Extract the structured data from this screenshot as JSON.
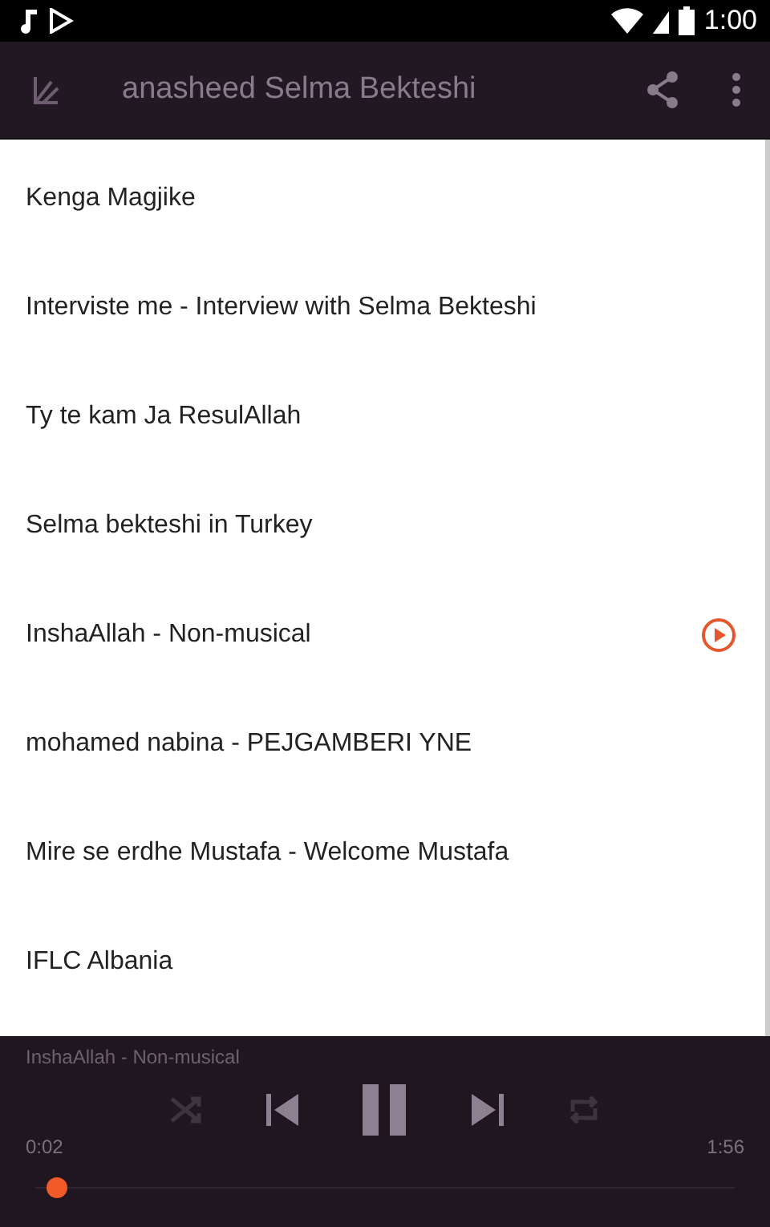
{
  "status_bar": {
    "time": "1:00"
  },
  "app_bar": {
    "title": "anasheed Selma Bekteshi"
  },
  "tracks": [
    {
      "title": "Kenga Magjike",
      "playing": false
    },
    {
      "title": "Interviste me - Interview with Selma Bekteshi",
      "playing": false
    },
    {
      "title": "Ty te kam Ja ResulAllah",
      "playing": false
    },
    {
      "title": "Selma bekteshi in Turkey",
      "playing": false
    },
    {
      "title": "InshaAllah - Non-musical",
      "playing": true
    },
    {
      "title": "mohamed nabina - PEJGAMBERI YNE",
      "playing": false
    },
    {
      "title": "Mire se erdhe Mustafa - Welcome Mustafa",
      "playing": false
    },
    {
      "title": "IFLC Albania",
      "playing": false
    }
  ],
  "player": {
    "now_playing": "InshaAllah - Non-musical",
    "shuffle": false,
    "repeat": false,
    "paused": false,
    "elapsed": "0:02",
    "duration": "1:56",
    "level": 0.017
  }
}
